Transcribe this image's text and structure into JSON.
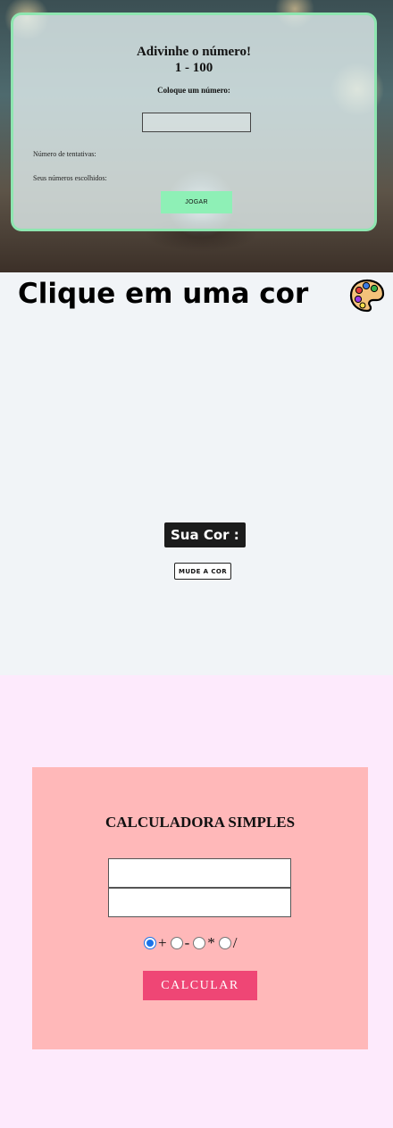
{
  "guess_game": {
    "title": "Adivinhe o número!",
    "range": "1 - 100",
    "prompt": "Coloque um número:",
    "input_value": "",
    "attempts_label": "Número de tentativas:",
    "chosen_numbers_label": "Seus números escolhidos:",
    "play_button": "JOGAR",
    "accent_color": "#8ee6b0"
  },
  "color_picker": {
    "heading": "Clique em uma cor",
    "heading_icon": "palette-icon",
    "current_color_label": "Sua Cor :",
    "change_button": "MUDE A COR",
    "background_color": "#f1f4f7"
  },
  "calculator": {
    "title": "CALCULADORA SIMPLES",
    "input_a_value": "",
    "input_b_value": "",
    "operations": [
      "+",
      "-",
      "*",
      "/"
    ],
    "selected_operation": "+",
    "calculate_button": "CALCULAR",
    "button_color": "#ef4675",
    "card_color": "#ffb8b9",
    "background_color": "#fdeafc"
  }
}
